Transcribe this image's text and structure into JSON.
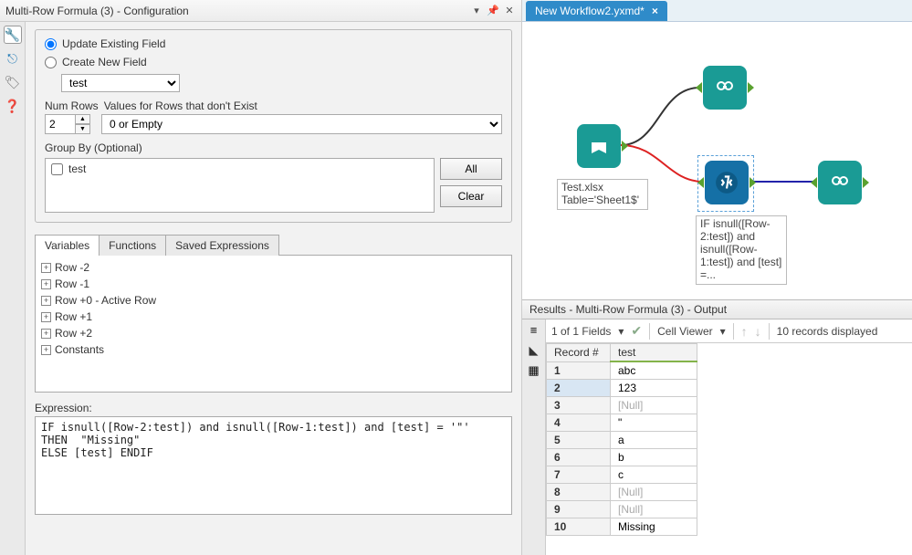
{
  "config": {
    "title": "Multi-Row Formula (3) - Configuration",
    "radio_update": "Update Existing Field",
    "radio_create": "Create New  Field",
    "field_select": "test",
    "num_rows_label": "Num Rows",
    "num_rows_value": "2",
    "values_label": "Values for Rows that don't Exist",
    "values_select": "0 or Empty",
    "group_by_label": "Group By (Optional)",
    "group_by_items": [
      "test"
    ],
    "btn_all": "All",
    "btn_clear": "Clear",
    "tabs": {
      "variables": "Variables",
      "functions": "Functions",
      "saved": "Saved Expressions"
    },
    "tree": [
      "Row -2",
      "Row -1",
      "Row +0 - Active Row",
      "Row +1",
      "Row +2",
      "Constants"
    ],
    "expression_label": "Expression:",
    "expression": "IF isnull([Row-2:test]) and isnull([Row-1:test]) and [test] = '\"'\nTHEN  \"Missing\"\nELSE [test] ENDIF"
  },
  "workflow": {
    "tab_name": "New Workflow2.yxmd*",
    "input_label": "Test.xlsx\nTable='Sheet1$'",
    "formula_label": "IF isnull([Row-2:test]) and isnull([Row-1:test]) and [test] =..."
  },
  "results": {
    "title": "Results - Multi-Row Formula (3) - Output",
    "fields_text": "1 of 1 Fields",
    "cell_viewer": "Cell Viewer",
    "records_text": "10 records displayed",
    "col_record": "Record #",
    "col_test": "test",
    "rows": [
      {
        "n": "1",
        "v": "abc",
        "null": false
      },
      {
        "n": "2",
        "v": "123",
        "null": false
      },
      {
        "n": "3",
        "v": "[Null]",
        "null": true
      },
      {
        "n": "4",
        "v": "\"",
        "null": false
      },
      {
        "n": "5",
        "v": "a",
        "null": false
      },
      {
        "n": "6",
        "v": "b",
        "null": false
      },
      {
        "n": "7",
        "v": "c",
        "null": false
      },
      {
        "n": "8",
        "v": "[Null]",
        "null": true
      },
      {
        "n": "9",
        "v": "[Null]",
        "null": true
      },
      {
        "n": "10",
        "v": "Missing",
        "null": false
      }
    ]
  }
}
